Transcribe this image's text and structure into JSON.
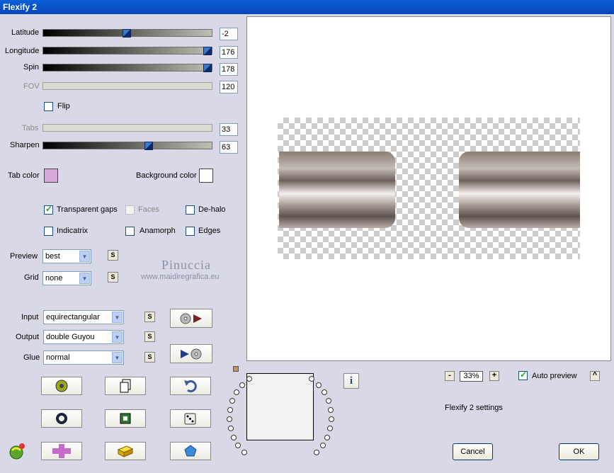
{
  "window": {
    "title": "Flexify 2"
  },
  "params": {
    "latitude": {
      "label": "Latitude",
      "value": "-2",
      "pos": 0.49
    },
    "longitude": {
      "label": "Longitude",
      "value": "176",
      "pos": 0.99
    },
    "spin": {
      "label": "Spin",
      "value": "178",
      "pos": 0.99
    },
    "fov": {
      "label": "FOV",
      "value": "120"
    },
    "flip": {
      "label": "Flip",
      "checked": false
    },
    "tabs": {
      "label": "Tabs",
      "value": "33"
    },
    "sharpen": {
      "label": "Sharpen",
      "value": "63",
      "pos": 0.63
    }
  },
  "colors": {
    "tab_label": "Tab color",
    "tab_value": "#d8a8d8",
    "bg_label": "Background color",
    "bg_value": "#ffffff"
  },
  "options": {
    "transparent_gaps": "Transparent gaps",
    "faces": "Faces",
    "de_halo": "De-halo",
    "indicatrix": "Indicatrix",
    "anamorph": "Anamorph",
    "edges": "Edges"
  },
  "preview_opts": {
    "label": "Preview",
    "value": "best",
    "s": "S"
  },
  "grid": {
    "label": "Grid",
    "value": "none",
    "s": "S"
  },
  "watermark": {
    "name": "Pinuccia",
    "url": "www.maidiregrafica.eu"
  },
  "mapping": {
    "input_label": "Input",
    "input_value": "equirectangular",
    "output_label": "Output",
    "output_value": "double Guyou",
    "glue_label": "Glue",
    "glue_value": "normal",
    "s": "S"
  },
  "zoom": {
    "minus": "-",
    "value": "33%",
    "plus": "+"
  },
  "auto_preview": {
    "label": "Auto preview",
    "checked": true,
    "expand": "^"
  },
  "settings_name": "Flexify 2 settings",
  "info": "i",
  "buttons": {
    "cancel": "Cancel",
    "ok": "OK"
  }
}
